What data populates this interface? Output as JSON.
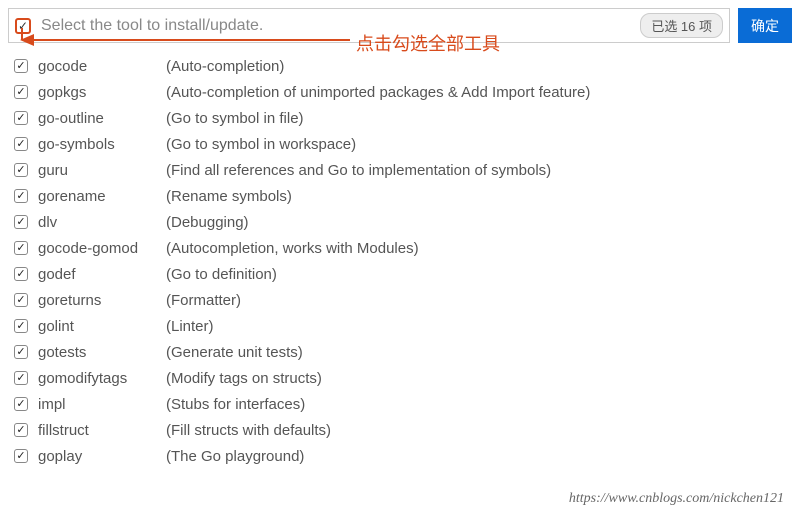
{
  "header": {
    "title": "Select the tool to install/update.",
    "badge": "已选 16 项",
    "confirm": "确定"
  },
  "annotation": "点击勾选全部工具",
  "tools": [
    {
      "name": "gocode",
      "desc": "(Auto-completion)"
    },
    {
      "name": "gopkgs",
      "desc": "(Auto-completion of unimported packages & Add Import feature)"
    },
    {
      "name": "go-outline",
      "desc": "(Go to symbol in file)"
    },
    {
      "name": "go-symbols",
      "desc": "(Go to symbol in workspace)"
    },
    {
      "name": "guru",
      "desc": "(Find all references and Go to implementation of symbols)"
    },
    {
      "name": "gorename",
      "desc": "(Rename symbols)"
    },
    {
      "name": "dlv",
      "desc": "(Debugging)"
    },
    {
      "name": "gocode-gomod",
      "desc": "(Autocompletion, works with Modules)"
    },
    {
      "name": "godef",
      "desc": "(Go to definition)"
    },
    {
      "name": "goreturns",
      "desc": "(Formatter)"
    },
    {
      "name": "golint",
      "desc": "(Linter)"
    },
    {
      "name": "gotests",
      "desc": "(Generate unit tests)"
    },
    {
      "name": "gomodifytags",
      "desc": "(Modify tags on structs)"
    },
    {
      "name": "impl",
      "desc": "(Stubs for interfaces)"
    },
    {
      "name": "fillstruct",
      "desc": "(Fill structs with defaults)"
    },
    {
      "name": "goplay",
      "desc": "(The Go playground)"
    }
  ],
  "watermark": "https://www.cnblogs.com/nickchen121"
}
